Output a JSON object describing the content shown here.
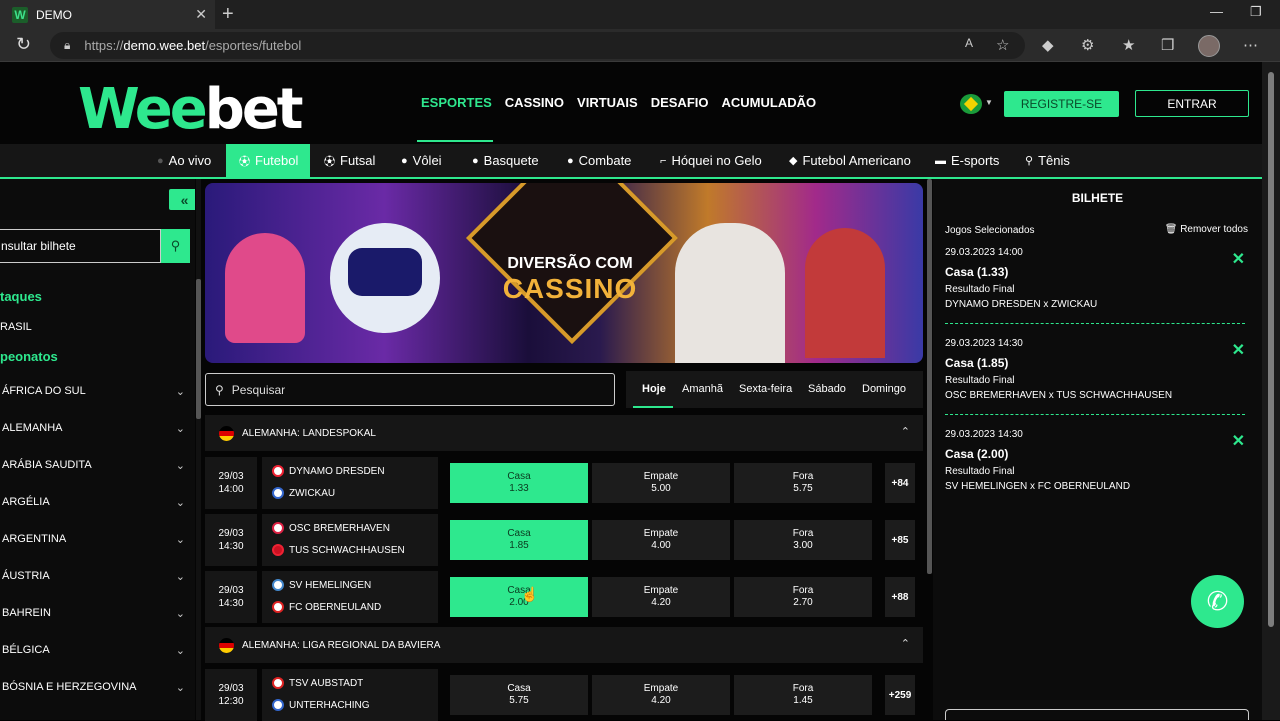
{
  "browser": {
    "tab_title": "DEMO",
    "tab_favicon": "W",
    "url_scheme": "https://",
    "url_host": "demo.wee.bet",
    "url_path": "/esportes/futebol"
  },
  "header": {
    "logo_part1": "Wee",
    "logo_part2": "bet",
    "nav": [
      "ESPORTES",
      "CASSINO",
      "VIRTUAIS",
      "DESAFIO",
      "ACUMULADÃO"
    ],
    "register_label": "REGISTRE-SE",
    "login_label": "ENTRAR"
  },
  "sports": [
    {
      "label": "Ao vivo",
      "icon": "live-dot-icon"
    },
    {
      "label": "Futebol",
      "icon": "soccer-ball-icon"
    },
    {
      "label": "Futsal",
      "icon": "soccer-ball-icon"
    },
    {
      "label": "Vôlei",
      "icon": "volleyball-icon"
    },
    {
      "label": "Basquete",
      "icon": "basketball-icon"
    },
    {
      "label": "Combate",
      "icon": "glove-icon"
    },
    {
      "label": "Hóquei no Gelo",
      "icon": "hockey-stick-icon"
    },
    {
      "label": "Futebol Americano",
      "icon": "american-football-icon"
    },
    {
      "label": "E-sports",
      "icon": "gamepad-icon"
    },
    {
      "label": "Tênis",
      "icon": "tennis-racket-icon"
    }
  ],
  "sidebar": {
    "ticket_placeholder": "nsultar bilhete",
    "highlights_title": "taques",
    "highlights_item": "RASIL",
    "championships_title": "peonatos",
    "countries": [
      "ÁFRICA DO SUL",
      "ALEMANHA",
      "ARÁBIA SAUDITA",
      "ARGÉLIA",
      "ARGENTINA",
      "ÁUSTRIA",
      "BAHREIN",
      "BÉLGICA",
      "BÓSNIA E HERZEGOVINA"
    ]
  },
  "banner": {
    "line1": "DIVERSÃO COM",
    "line2": "CASSINO"
  },
  "search": {
    "placeholder": "Pesquisar"
  },
  "day_tabs": [
    "Hoje",
    "Amanhã",
    "Sexta-feira",
    "Sábado",
    "Domingo"
  ],
  "leagues": [
    {
      "name": "ALEMANHA: LANDESPOKAL",
      "matches": [
        {
          "date": "29/03",
          "time": "14:00",
          "home": "DYNAMO DRESDEN",
          "away": "ZWICKAU",
          "odds": [
            {
              "label": "Casa",
              "value": "1.33"
            },
            {
              "label": "Empate",
              "value": "5.00"
            },
            {
              "label": "Fora",
              "value": "5.75"
            }
          ],
          "more": "+84"
        },
        {
          "date": "29/03",
          "time": "14:30",
          "home": "OSC BREMERHAVEN",
          "away": "TUS SCHWACHHAUSEN",
          "odds": [
            {
              "label": "Casa",
              "value": "1.85"
            },
            {
              "label": "Empate",
              "value": "4.00"
            },
            {
              "label": "Fora",
              "value": "3.00"
            }
          ],
          "more": "+85"
        },
        {
          "date": "29/03",
          "time": "14:30",
          "home": "SV HEMELINGEN",
          "away": "FC OBERNEULAND",
          "odds": [
            {
              "label": "Casa",
              "value": "2.00"
            },
            {
              "label": "Empate",
              "value": "4.20"
            },
            {
              "label": "Fora",
              "value": "2.70"
            }
          ],
          "more": "+88"
        }
      ]
    },
    {
      "name": "ALEMANHA: LIGA REGIONAL DA BAVIERA",
      "matches": [
        {
          "date": "29/03",
          "time": "12:30",
          "home": "TSV AUBSTADT",
          "away": "UNTERHACHING",
          "odds": [
            {
              "label": "Casa",
              "value": "5.75"
            },
            {
              "label": "Empate",
              "value": "4.20"
            },
            {
              "label": "Fora",
              "value": "1.45"
            }
          ],
          "more": "+259"
        }
      ]
    }
  ],
  "slip": {
    "title": "BILHETE",
    "selected_label": "Jogos Selecionados",
    "remove_all": "Remover todos",
    "bets": [
      {
        "datetime": "29.03.2023 14:00",
        "pick": "Casa (1.33)",
        "market": "Resultado Final",
        "game": "DYNAMO DRESDEN x ZWICKAU"
      },
      {
        "datetime": "29.03.2023 14:30",
        "pick": "Casa (1.85)",
        "market": "Resultado Final",
        "game": "OSC BREMERHAVEN x TUS SCHWACHHAUSEN"
      },
      {
        "datetime": "29.03.2023 14:30",
        "pick": "Casa (2.00)",
        "market": "Resultado Final",
        "game": "SV HEMELINGEN x FC OBERNEULAND"
      }
    ]
  },
  "colors": {
    "accent": "#2ee88e",
    "background": "#050505",
    "panel": "#161616"
  }
}
